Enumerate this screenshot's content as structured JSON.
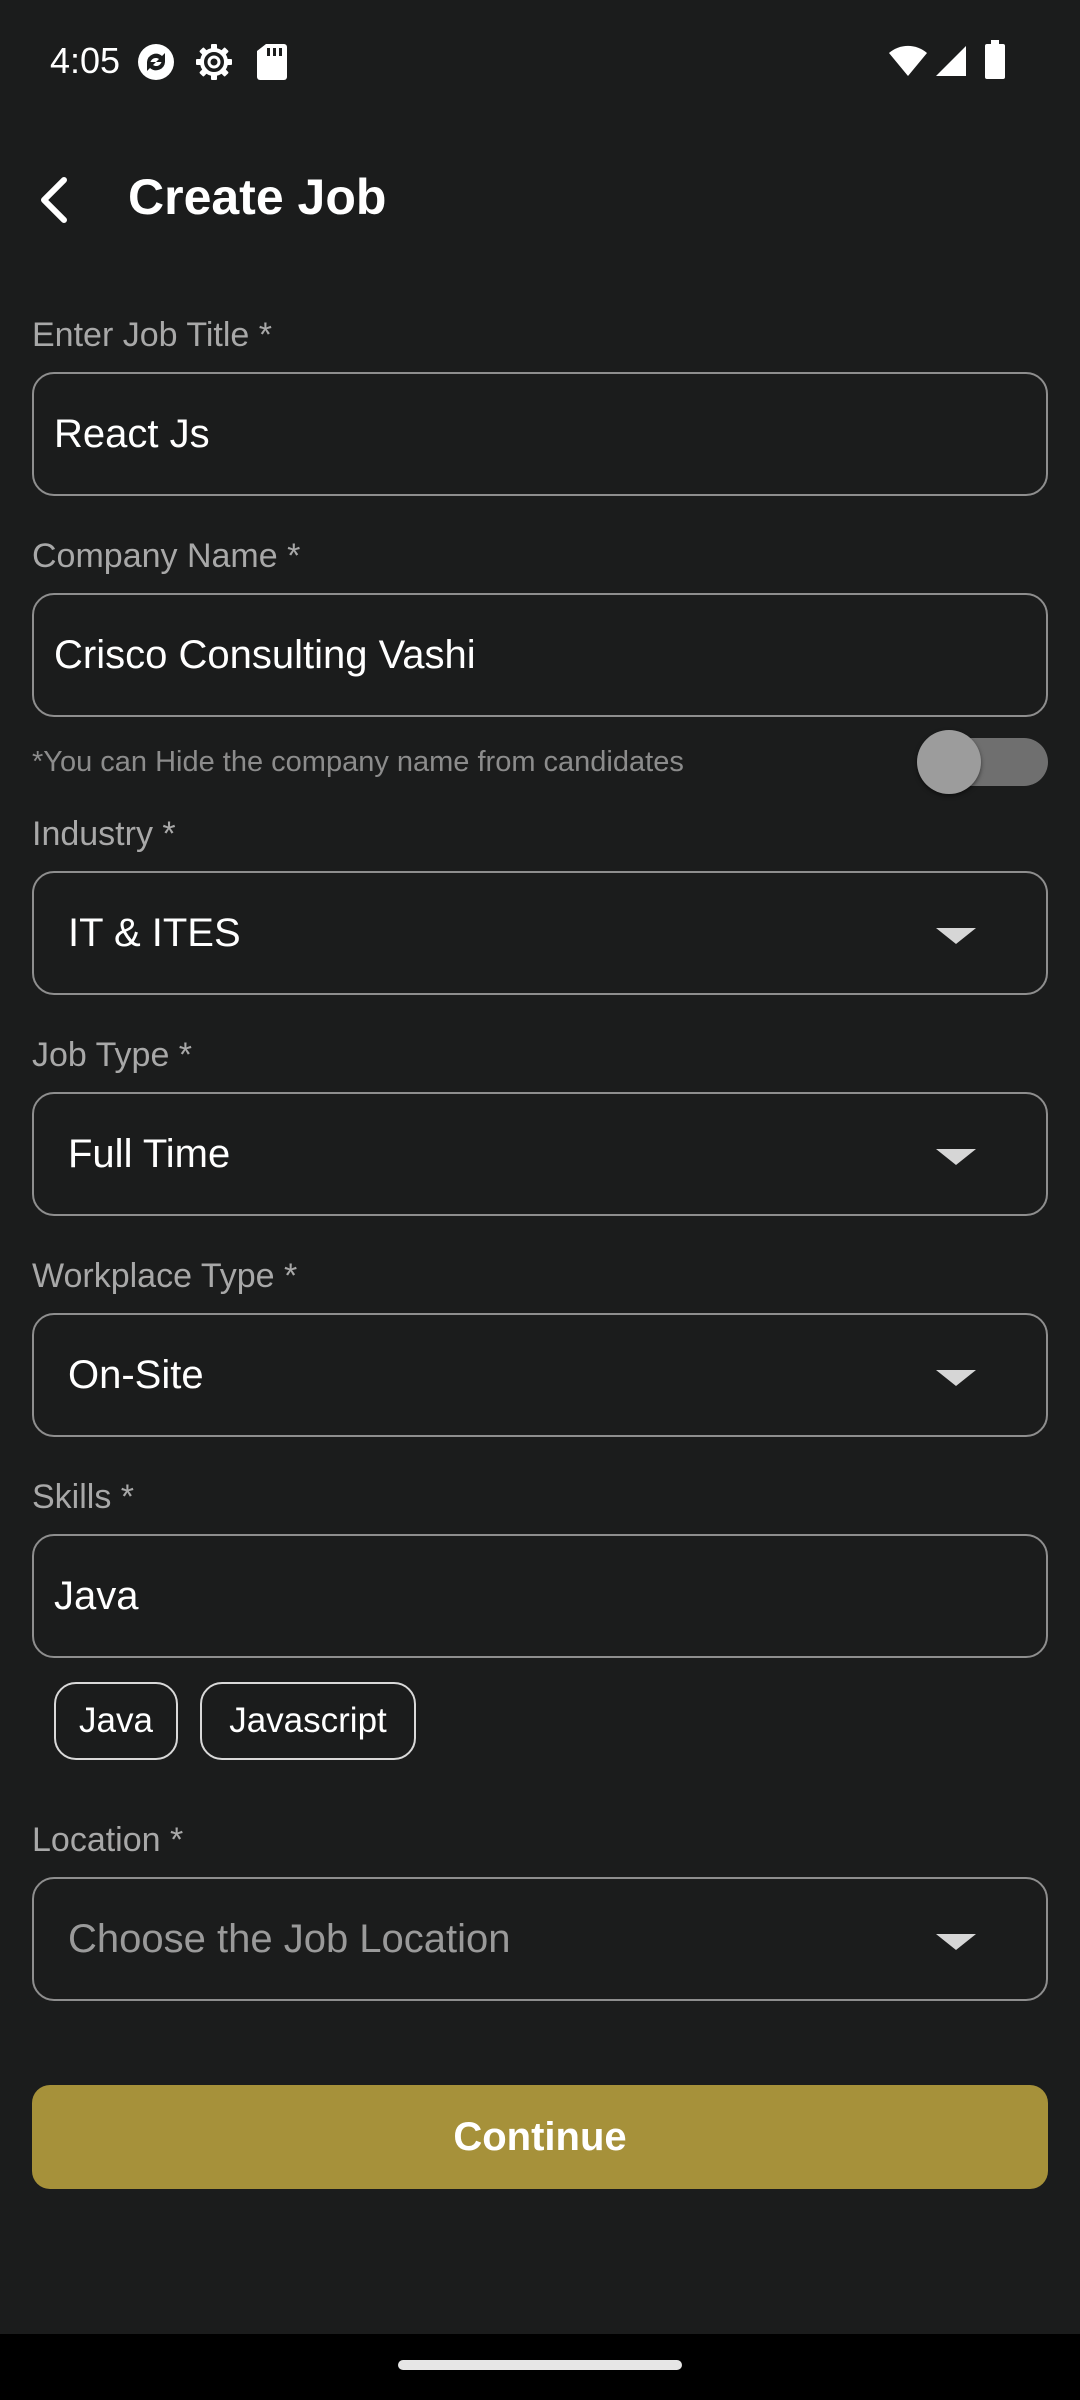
{
  "status_bar": {
    "time": "4:05",
    "icons_left": [
      "sync-icon",
      "settings-icon",
      "sd-card-icon"
    ],
    "icons_right": [
      "wifi-icon",
      "signal-icon",
      "battery-icon"
    ]
  },
  "app_bar": {
    "back_icon": "back-arrow-icon",
    "title": "Create Job"
  },
  "form": {
    "job_title": {
      "label": "Enter Job Title *",
      "value": "React Js"
    },
    "company_name": {
      "label": "Company Name *",
      "value": "Crisco Consulting Vashi"
    },
    "hide_company": {
      "hint": "*You can Hide the company name from candidates",
      "toggle_on": false
    },
    "industry": {
      "label": "Industry *",
      "value": "IT & ITES"
    },
    "job_type": {
      "label": "Job Type *",
      "value": "Full Time"
    },
    "workplace_type": {
      "label": "Workplace Type *",
      "value": "On-Site"
    },
    "skills": {
      "label": "Skills *",
      "value": "Java",
      "chips": [
        "Java",
        "Javascript"
      ]
    },
    "location": {
      "label": "Location *",
      "placeholder": "Choose the Job Location"
    }
  },
  "continue_label": "Continue",
  "colors": {
    "background": "#1b1c1c",
    "accent": "#a6913a",
    "border": "#8e8e8e"
  }
}
